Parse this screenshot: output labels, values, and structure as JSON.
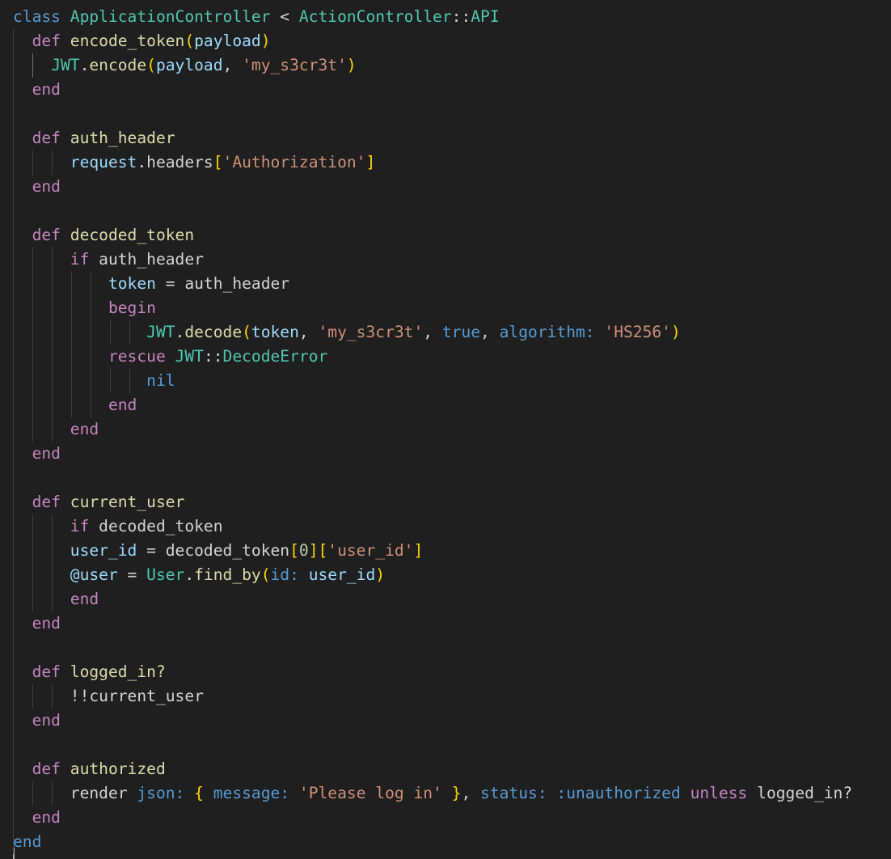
{
  "editor": {
    "language": "ruby",
    "theme_colors": {
      "background": "#1f1f1f",
      "keyword": "#c586c0",
      "class_name": "#4ec9b0",
      "function": "#dcdcaa",
      "variable": "#9cdcfe",
      "string": "#ce9178",
      "number": "#b5cea8",
      "constant": "#569cd6",
      "bracket_level_1": "#ffd700",
      "bracket_level_2": "#da70d6",
      "bracket_level_3": "#179fff"
    },
    "lines": [
      [
        {
          "t": "class ",
          "c": "kw-class"
        },
        {
          "t": "ApplicationController",
          "c": "cls"
        },
        {
          "t": " < ",
          "c": "op"
        },
        {
          "t": "ActionController",
          "c": "cls"
        },
        {
          "t": "::",
          "c": "op"
        },
        {
          "t": "API",
          "c": "cls"
        }
      ],
      [
        {
          "t": "  "
        },
        {
          "t": "def ",
          "c": "kw-def"
        },
        {
          "t": "encode_token",
          "c": "fn"
        },
        {
          "t": "(",
          "c": "br1"
        },
        {
          "t": "payload",
          "c": "var"
        },
        {
          "t": ")",
          "c": "br1"
        }
      ],
      [
        {
          "t": "    "
        },
        {
          "t": "JWT",
          "c": "cls"
        },
        {
          "t": ".",
          "c": "op"
        },
        {
          "t": "encode",
          "c": "fn"
        },
        {
          "t": "(",
          "c": "br1"
        },
        {
          "t": "payload",
          "c": "var"
        },
        {
          "t": ", ",
          "c": "op"
        },
        {
          "t": "'my_s3cr3t'",
          "c": "str"
        },
        {
          "t": ")",
          "c": "br1"
        }
      ],
      [
        {
          "t": "  "
        },
        {
          "t": "end",
          "c": "kw-def"
        }
      ],
      [],
      [
        {
          "t": "  "
        },
        {
          "t": "def ",
          "c": "kw-def"
        },
        {
          "t": "auth_header",
          "c": "fn"
        }
      ],
      [
        {
          "t": "    "
        },
        {
          "t": "  "
        },
        {
          "t": "request",
          "c": "var"
        },
        {
          "t": ".",
          "c": "op"
        },
        {
          "t": "headers",
          "c": "plain"
        },
        {
          "t": "[",
          "c": "br1"
        },
        {
          "t": "'Authorization'",
          "c": "str"
        },
        {
          "t": "]",
          "c": "br1"
        }
      ],
      [
        {
          "t": "  "
        },
        {
          "t": "end",
          "c": "kw-def"
        }
      ],
      [],
      [
        {
          "t": "  "
        },
        {
          "t": "def ",
          "c": "kw-def"
        },
        {
          "t": "decoded_token",
          "c": "fn"
        }
      ],
      [
        {
          "t": "    "
        },
        {
          "t": "  "
        },
        {
          "t": "if ",
          "c": "kw-ctrl"
        },
        {
          "t": "auth_header",
          "c": "plain"
        }
      ],
      [
        {
          "t": "        "
        },
        {
          "t": "  "
        },
        {
          "t": "token",
          "c": "var"
        },
        {
          "t": " = ",
          "c": "op"
        },
        {
          "t": "auth_header",
          "c": "plain"
        }
      ],
      [
        {
          "t": "        "
        },
        {
          "t": "  "
        },
        {
          "t": "begin",
          "c": "kw-ctrl"
        }
      ],
      [
        {
          "t": "          "
        },
        {
          "t": "    "
        },
        {
          "t": "JWT",
          "c": "cls"
        },
        {
          "t": ".",
          "c": "op"
        },
        {
          "t": "decode",
          "c": "fn"
        },
        {
          "t": "(",
          "c": "br1"
        },
        {
          "t": "token",
          "c": "var"
        },
        {
          "t": ", ",
          "c": "op"
        },
        {
          "t": "'my_s3cr3t'",
          "c": "str"
        },
        {
          "t": ", ",
          "c": "op"
        },
        {
          "t": "true",
          "c": "const"
        },
        {
          "t": ", ",
          "c": "op"
        },
        {
          "t": "algorithm:",
          "c": "key"
        },
        {
          "t": " ",
          "c": "op"
        },
        {
          "t": "'HS256'",
          "c": "str"
        },
        {
          "t": ")",
          "c": "br1"
        }
      ],
      [
        {
          "t": "        "
        },
        {
          "t": "  "
        },
        {
          "t": "rescue ",
          "c": "kw-ctrl"
        },
        {
          "t": "JWT",
          "c": "cls"
        },
        {
          "t": "::",
          "c": "op"
        },
        {
          "t": "DecodeError",
          "c": "cls"
        }
      ],
      [
        {
          "t": "          "
        },
        {
          "t": "    "
        },
        {
          "t": "nil",
          "c": "const"
        }
      ],
      [
        {
          "t": "        "
        },
        {
          "t": "  "
        },
        {
          "t": "end",
          "c": "kw-ctrl"
        }
      ],
      [
        {
          "t": "    "
        },
        {
          "t": "  "
        },
        {
          "t": "end",
          "c": "kw-ctrl"
        }
      ],
      [
        {
          "t": "  "
        },
        {
          "t": "end",
          "c": "kw-def"
        }
      ],
      [],
      [
        {
          "t": "  "
        },
        {
          "t": "def ",
          "c": "kw-def"
        },
        {
          "t": "current_user",
          "c": "fn"
        }
      ],
      [
        {
          "t": "    "
        },
        {
          "t": "  "
        },
        {
          "t": "if ",
          "c": "kw-ctrl"
        },
        {
          "t": "decoded_token",
          "c": "plain"
        }
      ],
      [
        {
          "t": "    "
        },
        {
          "t": "  "
        },
        {
          "t": "user_id",
          "c": "var"
        },
        {
          "t": " = ",
          "c": "op"
        },
        {
          "t": "decoded_token",
          "c": "plain"
        },
        {
          "t": "[",
          "c": "br1"
        },
        {
          "t": "0",
          "c": "num"
        },
        {
          "t": "]",
          "c": "br1"
        },
        {
          "t": "[",
          "c": "br1"
        },
        {
          "t": "'user_id'",
          "c": "str"
        },
        {
          "t": "]",
          "c": "br1"
        }
      ],
      [
        {
          "t": "    "
        },
        {
          "t": "  "
        },
        {
          "t": "@user",
          "c": "var"
        },
        {
          "t": " = ",
          "c": "op"
        },
        {
          "t": "User",
          "c": "cls"
        },
        {
          "t": ".",
          "c": "op"
        },
        {
          "t": "find_by",
          "c": "fn"
        },
        {
          "t": "(",
          "c": "br1"
        },
        {
          "t": "id:",
          "c": "key"
        },
        {
          "t": " ",
          "c": "op"
        },
        {
          "t": "user_id",
          "c": "var"
        },
        {
          "t": ")",
          "c": "br1"
        }
      ],
      [
        {
          "t": "    "
        },
        {
          "t": "  "
        },
        {
          "t": "end",
          "c": "kw-ctrl"
        }
      ],
      [
        {
          "t": "  "
        },
        {
          "t": "end",
          "c": "kw-def"
        }
      ],
      [],
      [
        {
          "t": "  "
        },
        {
          "t": "def ",
          "c": "kw-def"
        },
        {
          "t": "logged_in?",
          "c": "fn"
        }
      ],
      [
        {
          "t": "    "
        },
        {
          "t": "  "
        },
        {
          "t": "!!current_user",
          "c": "plain"
        }
      ],
      [
        {
          "t": "  "
        },
        {
          "t": "end",
          "c": "kw-def"
        }
      ],
      [],
      [
        {
          "t": "  "
        },
        {
          "t": "def ",
          "c": "kw-def"
        },
        {
          "t": "authorized",
          "c": "fn"
        }
      ],
      [
        {
          "t": "    "
        },
        {
          "t": "  "
        },
        {
          "t": "render ",
          "c": "plain"
        },
        {
          "t": "json:",
          "c": "key"
        },
        {
          "t": " ",
          "c": "op"
        },
        {
          "t": "{",
          "c": "br1"
        },
        {
          "t": " ",
          "c": "op"
        },
        {
          "t": "message:",
          "c": "key"
        },
        {
          "t": " ",
          "c": "op"
        },
        {
          "t": "'Please log in'",
          "c": "str"
        },
        {
          "t": " ",
          "c": "op"
        },
        {
          "t": "}",
          "c": "br1"
        },
        {
          "t": ", ",
          "c": "op"
        },
        {
          "t": "status:",
          "c": "key"
        },
        {
          "t": " ",
          "c": "op"
        },
        {
          "t": ":unauthorized",
          "c": "sym"
        },
        {
          "t": " ",
          "c": "op"
        },
        {
          "t": "unless",
          "c": "kw-ctrl"
        },
        {
          "t": " ",
          "c": "op"
        },
        {
          "t": "logged_in?",
          "c": "plain"
        }
      ],
      [
        {
          "t": "  "
        },
        {
          "t": "end",
          "c": "kw-def"
        }
      ],
      [
        {
          "t": "end",
          "c": "kw-class"
        }
      ]
    ]
  }
}
